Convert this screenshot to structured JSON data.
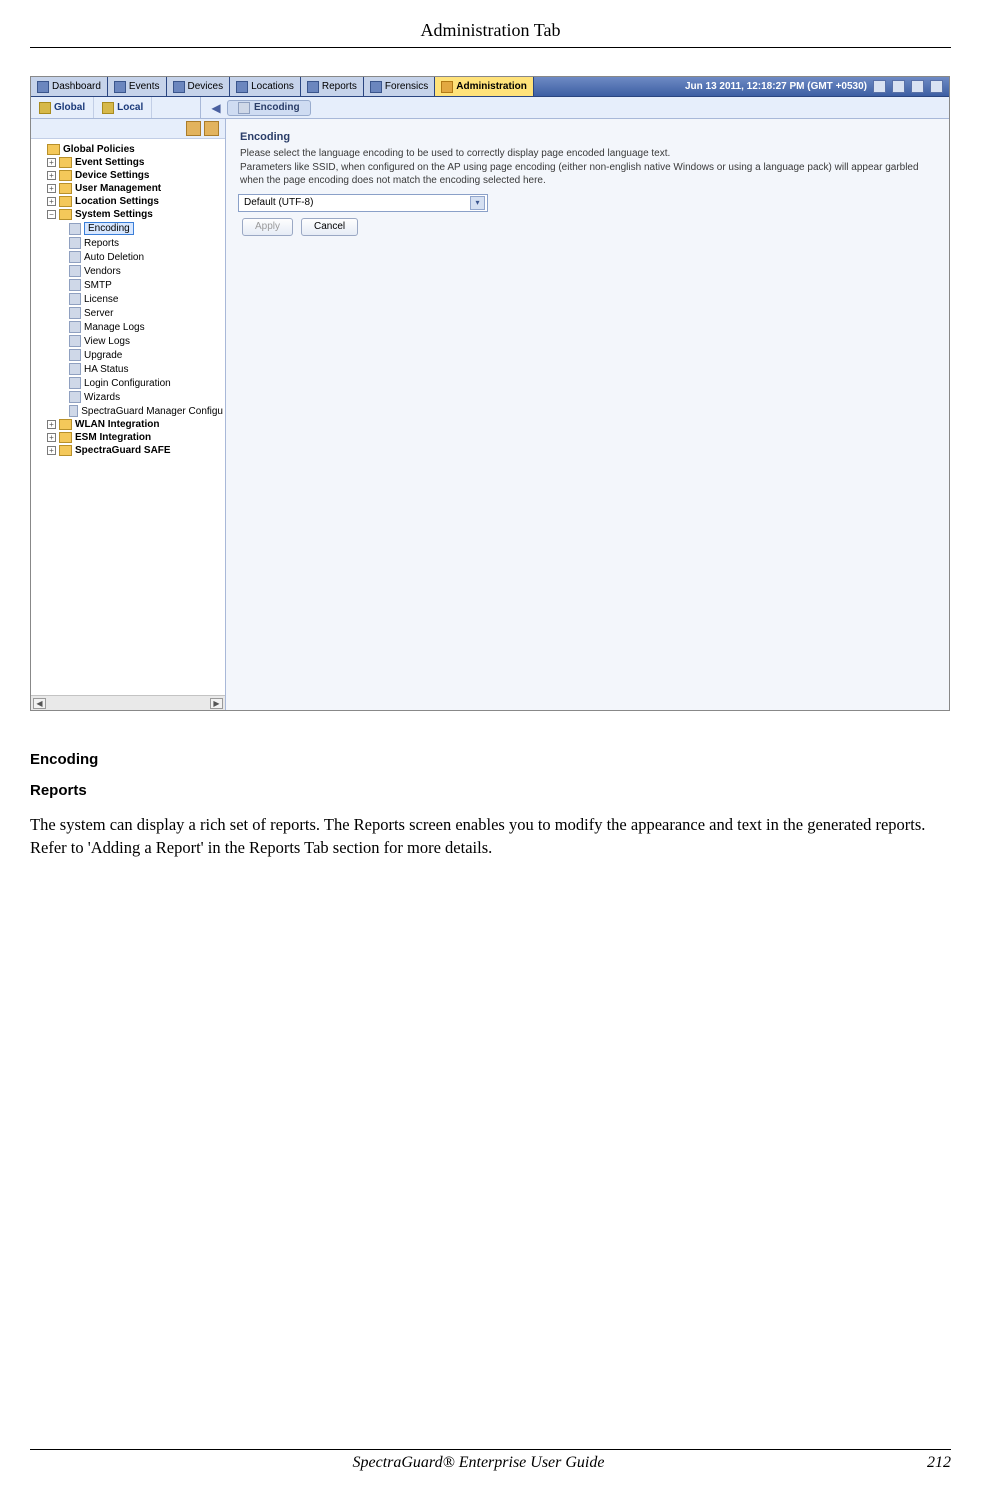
{
  "doc": {
    "header": "Administration Tab",
    "caption": "Encoding",
    "subsection": "Reports",
    "paragraph": "The system can display a rich set of reports. The Reports screen enables you to modify the appearance and text in the generated reports. Refer to 'Adding a Report' in the Reports Tab section for more details.",
    "footer_title": "SpectraGuard®  Enterprise User Guide",
    "page_num": "212"
  },
  "app": {
    "main_tabs": [
      "Dashboard",
      "Events",
      "Devices",
      "Locations",
      "Reports",
      "Forensics",
      "Administration"
    ],
    "active_main_tab": "Administration",
    "timestamp": "Jun 13 2011, 12:18:27 PM (GMT +0530)",
    "sub_tabs": {
      "global": "Global",
      "local": "Local"
    },
    "breadcrumb": "Encoding",
    "tree": {
      "root": "Global Policies",
      "children": [
        {
          "label": "Event Settings",
          "type": "folder",
          "expander": "+"
        },
        {
          "label": "Device Settings",
          "type": "folder",
          "expander": "+"
        },
        {
          "label": "User Management",
          "type": "folder",
          "expander": "+"
        },
        {
          "label": "Location Settings",
          "type": "folder",
          "expander": "+"
        },
        {
          "label": "System Settings",
          "type": "folder",
          "expander": "-",
          "children": [
            {
              "label": "Encoding",
              "selected": true
            },
            {
              "label": "Reports"
            },
            {
              "label": "Auto Deletion"
            },
            {
              "label": "Vendors"
            },
            {
              "label": "SMTP"
            },
            {
              "label": "License"
            },
            {
              "label": "Server"
            },
            {
              "label": "Manage Logs"
            },
            {
              "label": "View Logs"
            },
            {
              "label": "Upgrade"
            },
            {
              "label": "HA Status"
            },
            {
              "label": "Login Configuration"
            },
            {
              "label": "Wizards"
            },
            {
              "label": "SpectraGuard Manager Configu"
            }
          ]
        },
        {
          "label": "WLAN Integration",
          "type": "folder",
          "expander": "+"
        },
        {
          "label": "ESM Integration",
          "type": "folder",
          "expander": "+"
        },
        {
          "label": "SpectraGuard SAFE",
          "type": "folder",
          "expander": "+"
        }
      ]
    },
    "panel": {
      "title": "Encoding",
      "desc_line1": "Please select the language encoding to be used to correctly display page encoded language text.",
      "desc_line2": "Parameters like SSID, when configured on the AP using page encoding (either non-english native Windows or using a language pack) will appear garbled when the page encoding does not match the encoding selected here.",
      "dropdown_value": "Default (UTF-8)",
      "buttons": {
        "apply": "Apply",
        "cancel": "Cancel"
      }
    }
  }
}
